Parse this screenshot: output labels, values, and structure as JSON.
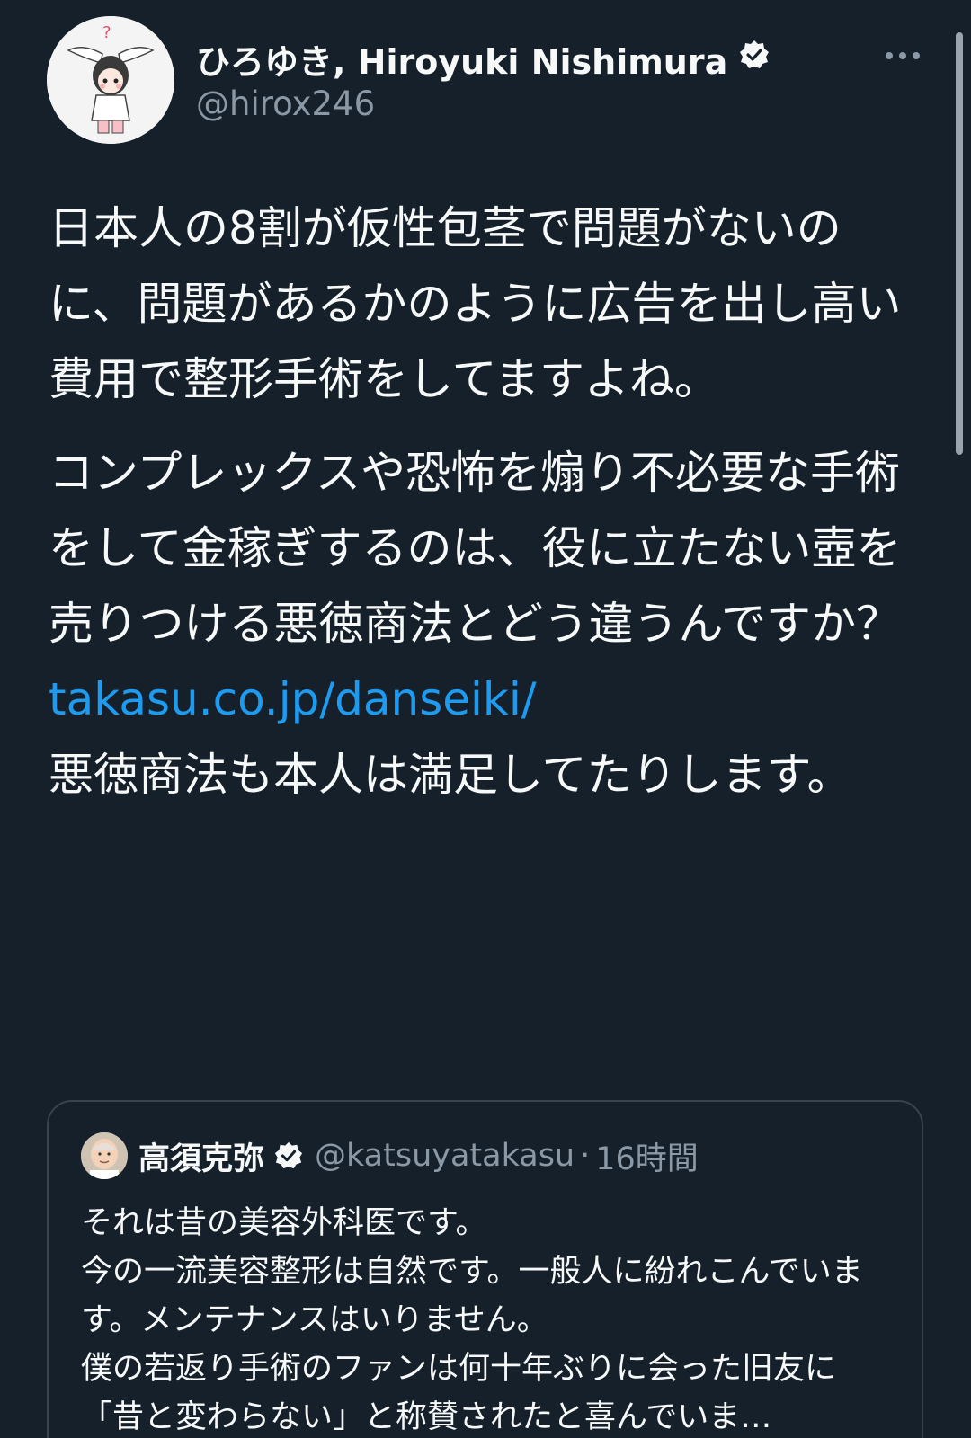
{
  "author": {
    "name": "ひろゆき, Hiroyuki Nishimura",
    "handle": "@hirox246"
  },
  "tweet": {
    "paragraph_1": "日本人の8割が仮性包茎で問題がないのに、問題があるかのように広告を出し高い費用で整形手術をしてますよね。",
    "paragraph_2": "コンプレックスや恐怖を煽り不必要な手術をして金稼ぎするのは、役に立たない壺を売りつける悪徳商法とどう違うんですか？",
    "link": "takasu.co.jp/danseiki/",
    "paragraph_3": "悪徳商法も本人は満足してたりします。"
  },
  "quoted": {
    "name": "高須克弥",
    "handle": "@katsuyatakasu",
    "separator": "·",
    "time": "16時間",
    "lines": [
      "それは昔の美容外科医です。",
      "今の一流美容整形は自然です。一般人に紛れこんでいます。メンテナンスはいりません。",
      "僕の若返り手術のファンは何十年ぶりに会った旧友に「昔と変わらない」と称賛されたと喜んでいま…"
    ]
  },
  "colors": {
    "background": "#15202b",
    "text": "#f7f9f9",
    "secondary": "#8b98a5",
    "link": "#1d9bf0",
    "border": "#38444d"
  },
  "icons": [
    "verified-badge-icon",
    "more-options-icon"
  ]
}
